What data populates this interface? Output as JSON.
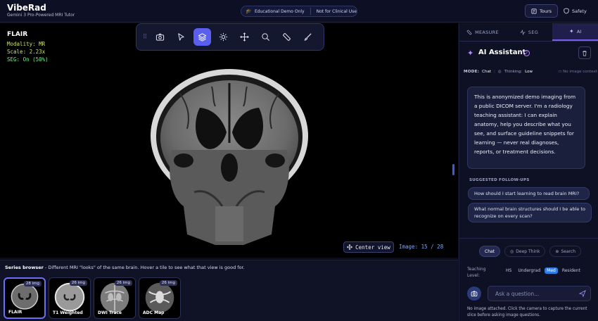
{
  "header": {
    "app_name": "VibeRad",
    "subtitle": "Gemini 3 Pro-Powered MRI Tutor",
    "pill_left": "Educational Demo Only",
    "pill_right": "Not for Clinical Use",
    "tours_label": "Tours",
    "safety_label": "Safety"
  },
  "viewer": {
    "series_name": "FLAIR",
    "modality": "Modality: MR",
    "scale": "Scale: 2.23x",
    "seg": "SEG: On (50%)",
    "center_view": "Center view",
    "image_counter": "Image: 15 / 28",
    "tools": [
      "camera-icon",
      "pointer-icon",
      "layers-icon",
      "brightness-icon",
      "move-icon",
      "zoom-icon",
      "ruler-icon",
      "brush-icon"
    ],
    "active_tool": "layers-icon"
  },
  "series_browser": {
    "title": "Series browser",
    "description": " - Different MRI \"looks\" of the same brain. Hover a tile to see what that view is good for.",
    "tiles": [
      {
        "name": "FLAIR",
        "count": "28 img"
      },
      {
        "name": "T1 Weighted",
        "count": "26 img"
      },
      {
        "name": "DWI Trace",
        "count": "26 img"
      },
      {
        "name": "ADC Map",
        "count": "26 img"
      }
    ]
  },
  "panel": {
    "tabs": [
      "MEASURE",
      "SEG",
      "AI"
    ],
    "active_tab": "AI",
    "ai_title": "AI Assistant",
    "mode_label": "MODE:",
    "mode_value": "Chat",
    "thinking_label": "Thinking:",
    "thinking_value": "Low",
    "no_image_context": "No image context",
    "message": "This is anonymized demo imaging from a public DICOM server. I'm a radiology teaching assistant: I can explain anatomy, help you describe what you see, and surface guideline snippets for learning — never real diagnoses, reports, or treatment decisions.",
    "followups_label": "SUGGESTED FOLLOW-UPS",
    "followups": [
      "How should I start learning to read brain MRI?",
      "What normal brain structures should I be able to recognize on every scan?"
    ],
    "modes": [
      "Chat",
      "Deep Think",
      "Search"
    ],
    "teaching_label": "Teaching Level:",
    "levels": [
      "HS",
      "Undergrad",
      "Med",
      "Resident"
    ],
    "active_level": "Med",
    "ask_placeholder": "Ask a question...",
    "note": "No image attached. Click the camera to capture the current slice before asking image questions."
  },
  "colors": {
    "accent": "#5b5ff0",
    "ai_tab": "#7c5cf0",
    "active_level": "#2f7de6",
    "overlay_text": "#c8e36a",
    "seg_text": "#6ef08a",
    "image_counter": "#7aa6ff"
  }
}
